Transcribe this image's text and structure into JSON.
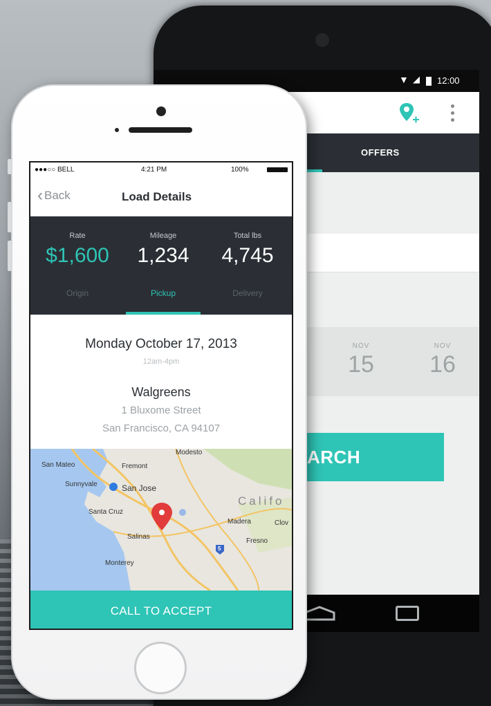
{
  "android": {
    "status_time": "12:00",
    "tab_offers": "OFFERS",
    "dates": [
      {
        "month": "NOV",
        "day": "15"
      },
      {
        "month": "NOV",
        "day": "16"
      }
    ],
    "search_label": "ARCH"
  },
  "iphone": {
    "status": {
      "carrier": "●●●○○ BELL",
      "time": "4:21 PM",
      "battery": "100%"
    },
    "nav": {
      "back_label": "Back",
      "title": "Load Details"
    },
    "stats": [
      {
        "label": "Rate",
        "value": "$1,600"
      },
      {
        "label": "Mileage",
        "value": "1,234"
      },
      {
        "label": "Total lbs",
        "value": "4,745"
      }
    ],
    "subtabs": [
      "Origin",
      "Pickup",
      "Delivery"
    ],
    "active_subtab": "Pickup",
    "pickup": {
      "date": "Monday October 17, 2013",
      "window": "12am-4pm",
      "store": "Walgreens",
      "address_line1": "1 Bluxome Street",
      "address_line2": "San Francisco, CA 94107"
    },
    "map_labels": {
      "san_mateo": "San Mateo",
      "fremont": "Fremont",
      "sunnyvale": "Sunnyvale",
      "san_jose": "San Jose",
      "santa_cruz": "Santa Cruz",
      "salinas": "Salinas",
      "monterey": "Monterey",
      "california": "Califo",
      "madera": "Madera",
      "fresno": "Fresno",
      "clovis": "Clov",
      "modesto": "Modesto",
      "highway": "5"
    },
    "cta_label": "CALL TO ACCEPT"
  },
  "colors": {
    "accent": "#2ec4b6",
    "dark_panel": "#2b2f35"
  }
}
